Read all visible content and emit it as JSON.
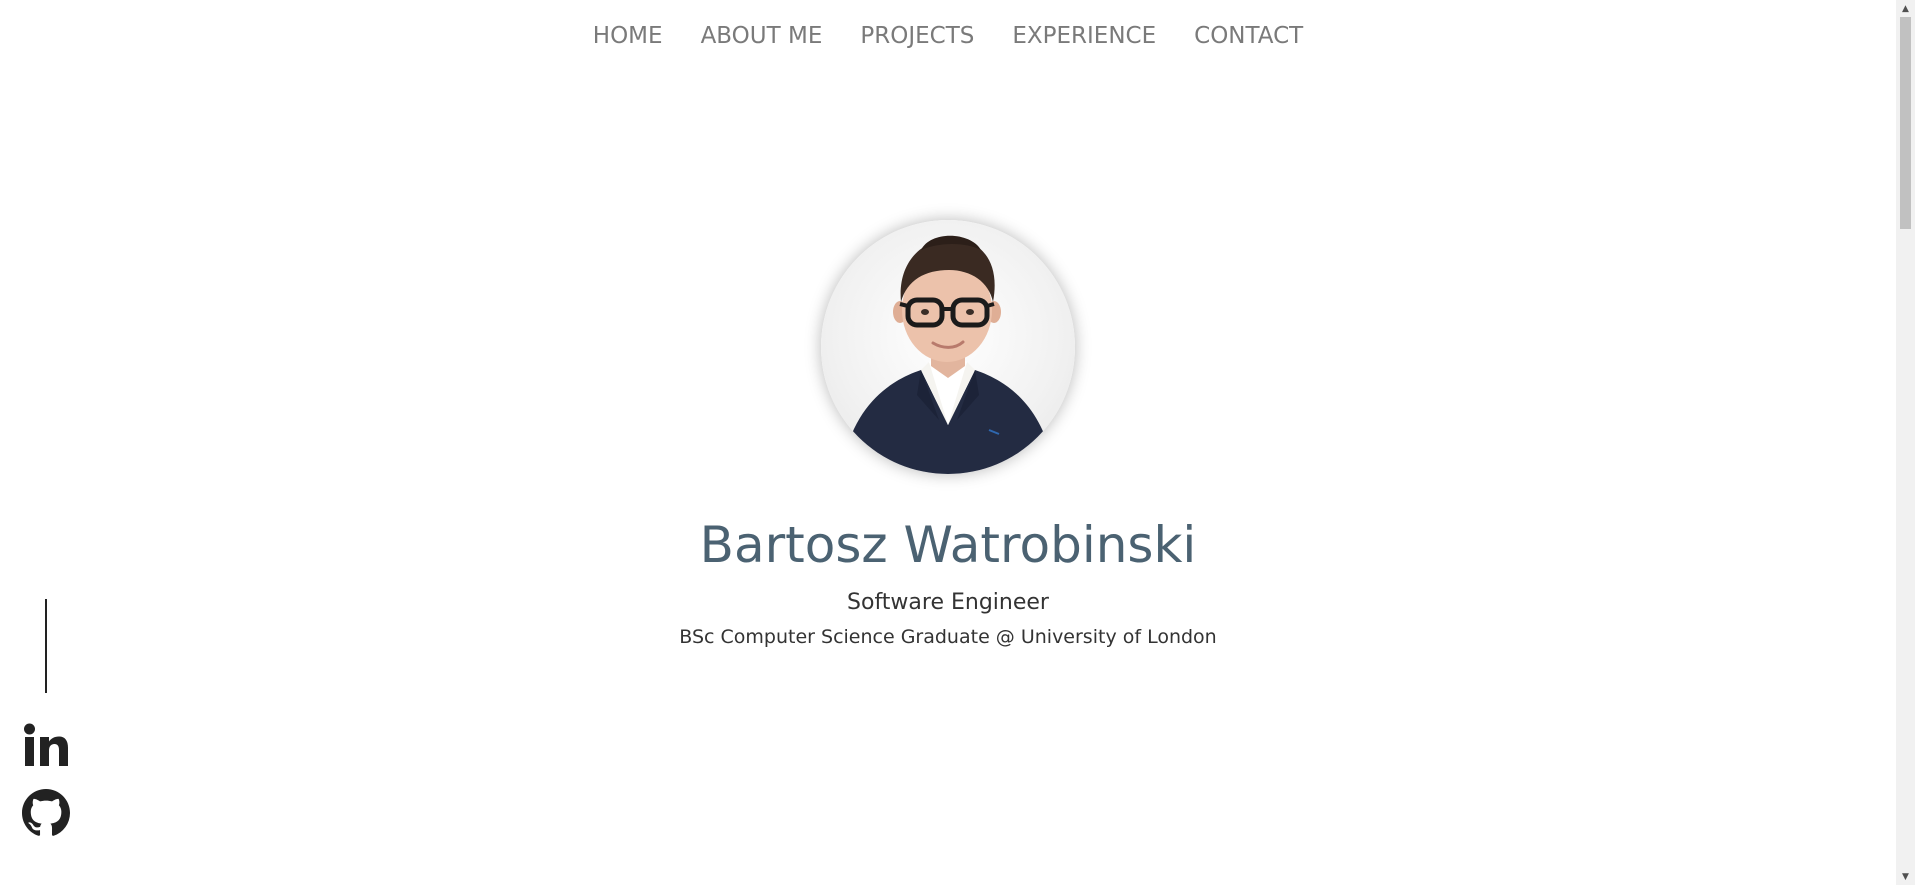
{
  "nav": {
    "items": [
      {
        "label": "HOME"
      },
      {
        "label": "ABOUT ME"
      },
      {
        "label": "PROJECTS"
      },
      {
        "label": "EXPERIENCE"
      },
      {
        "label": "CONTACT"
      }
    ]
  },
  "hero": {
    "name": "Bartosz Watrobinski",
    "role": "Software Engineer",
    "education": "BSc Computer Science Graduate @ University of London"
  },
  "social": {
    "icons": [
      "linkedin-icon",
      "github-icon"
    ]
  },
  "colors": {
    "nav_text": "#7a7a7a",
    "name_text": "#4b6272",
    "body_text": "#333333",
    "icon": "#222222"
  },
  "scrollbar": {
    "up_arrow": "▲",
    "down_arrow": "▼"
  }
}
